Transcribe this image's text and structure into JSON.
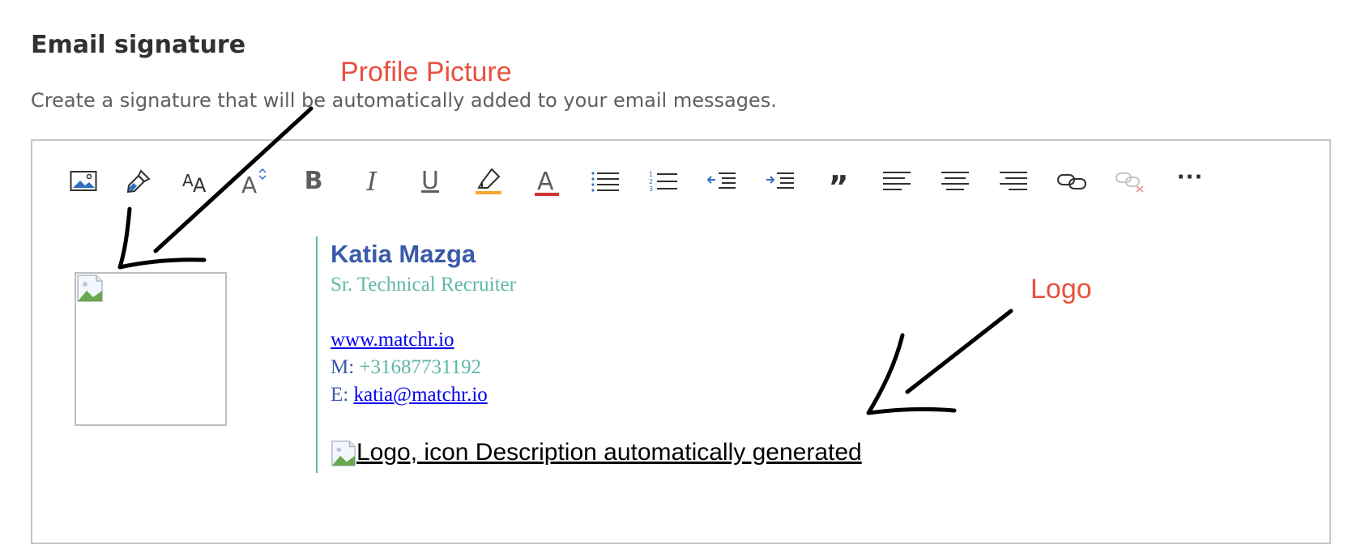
{
  "page": {
    "heading": "Email signature",
    "description": "Create a signature that will be automatically added to your email messages."
  },
  "toolbar": {
    "items": [
      {
        "name": "insert-picture",
        "icon": "image-icon"
      },
      {
        "name": "format-painter",
        "icon": "paintbrush-icon"
      },
      {
        "name": "font-size",
        "icon": "font-size-icon"
      },
      {
        "name": "font-size-increase",
        "icon": "font-grow-icon"
      },
      {
        "name": "bold",
        "icon": "bold-icon",
        "glyph": "B"
      },
      {
        "name": "italic",
        "icon": "italic-icon",
        "glyph": "I"
      },
      {
        "name": "underline",
        "icon": "underline-icon",
        "glyph": "U"
      },
      {
        "name": "highlight",
        "icon": "highlighter-icon",
        "color": "#f7a630"
      },
      {
        "name": "font-color",
        "icon": "font-color-icon",
        "glyph": "A",
        "color": "#d13438"
      },
      {
        "name": "bullets",
        "icon": "bullet-list-icon"
      },
      {
        "name": "numbering",
        "icon": "numbered-list-icon"
      },
      {
        "name": "decrease-indent",
        "icon": "outdent-icon"
      },
      {
        "name": "increase-indent",
        "icon": "indent-icon"
      },
      {
        "name": "quote",
        "icon": "quote-icon",
        "glyph": "”"
      },
      {
        "name": "align-left",
        "icon": "align-left-icon"
      },
      {
        "name": "align-center",
        "icon": "align-center-icon"
      },
      {
        "name": "align-right",
        "icon": "align-right-icon"
      },
      {
        "name": "insert-link",
        "icon": "link-icon"
      },
      {
        "name": "remove-link",
        "icon": "unlink-icon",
        "disabled": true
      },
      {
        "name": "more-options",
        "icon": "more-icon",
        "glyph": "···"
      }
    ]
  },
  "signature": {
    "name": "Katia Mazga",
    "title": "Sr. Technical Recruiter",
    "website": "www.matchr.io",
    "phone_label": "M:",
    "phone": "+31687731192",
    "email_label": "E:",
    "email": "katia@matchr.io",
    "logo_alt": "Logo, icon Description automatically generated"
  },
  "annotations": {
    "profile_picture": "Profile Picture",
    "logo": "Logo"
  },
  "colors": {
    "accent_teal": "#5fb8a6",
    "name_blue": "#3b5ba9",
    "link_blue": "#0000ee",
    "annotation_red": "#e8513f"
  }
}
